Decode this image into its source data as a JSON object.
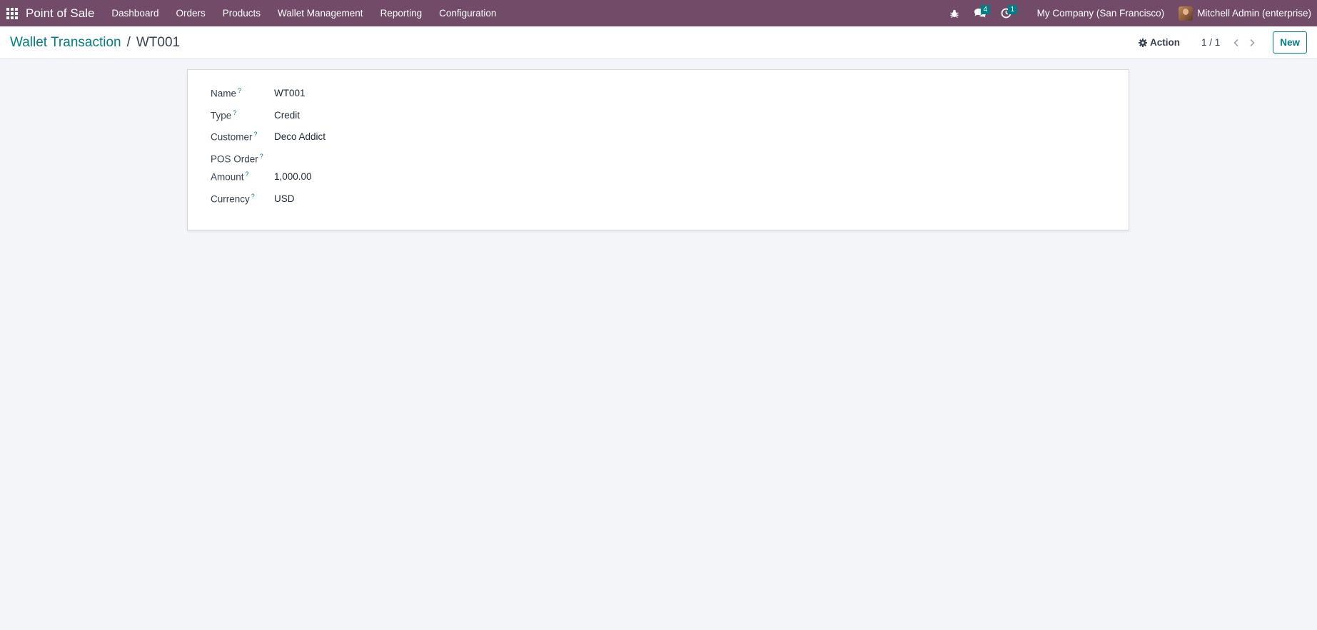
{
  "navbar": {
    "brand": "Point of Sale",
    "menu": [
      "Dashboard",
      "Orders",
      "Products",
      "Wallet Management",
      "Reporting",
      "Configuration"
    ],
    "messages_count": "4",
    "activities_count": "1",
    "company": "My Company (San Francisco)",
    "user": "Mitchell Admin (enterprise)"
  },
  "control_panel": {
    "breadcrumb_parent": "Wallet Transaction",
    "breadcrumb_separator": "/",
    "breadcrumb_current": "WT001",
    "action_label": "Action",
    "pager": "1 / 1",
    "new_label": "New"
  },
  "form": {
    "help_marker": "?",
    "fields": [
      {
        "label": "Name",
        "value": "WT001"
      },
      {
        "label": "Type",
        "value": "Credit"
      },
      {
        "label": "Customer",
        "value": "Deco Addict"
      },
      {
        "label": "POS Order",
        "value": ""
      },
      {
        "label": "Amount",
        "value": "1,000.00"
      },
      {
        "label": "Currency",
        "value": "USD"
      }
    ]
  },
  "colors": {
    "navbar_bg": "#714b67",
    "accent": "#017e84",
    "page_bg": "#f4f5f9"
  }
}
